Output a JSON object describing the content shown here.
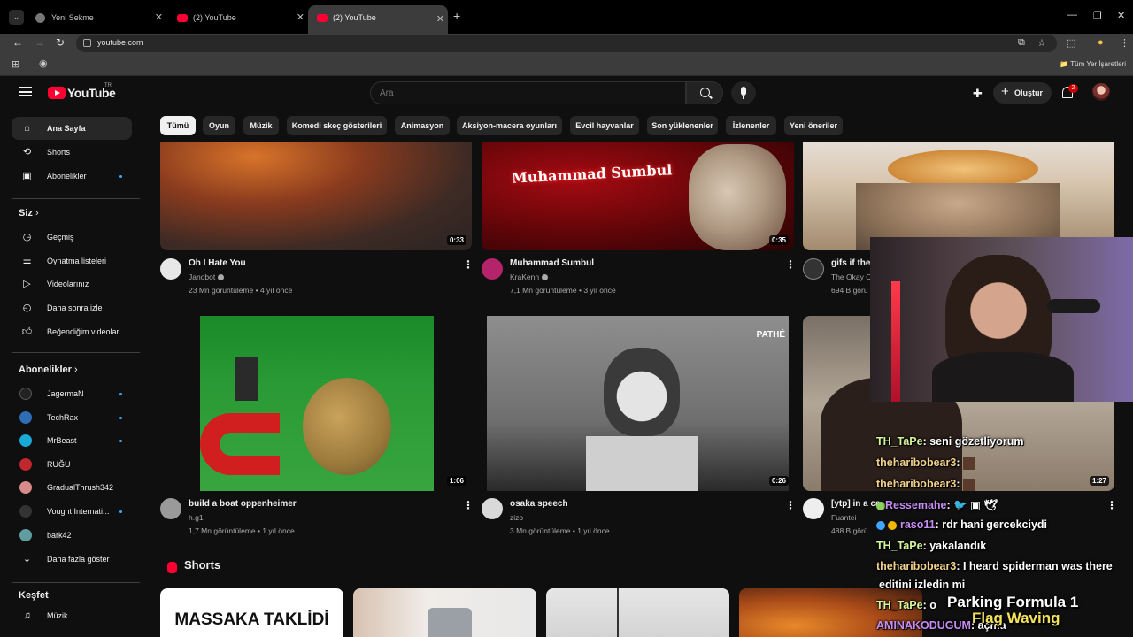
{
  "browser": {
    "tabs": [
      {
        "title": "Yeni Sekme"
      },
      {
        "title": "(2) YouTube"
      },
      {
        "title": "(2) YouTube"
      }
    ],
    "address": "youtube.com",
    "bookmarks_right": "Tüm Yer İşaretleri"
  },
  "masthead": {
    "logo_text": "YouTube",
    "country": "TR",
    "search_placeholder": "Ara",
    "create_label": "Oluştur",
    "notif_count": "2"
  },
  "sidebar": {
    "main": [
      {
        "label": "Ana Sayfa",
        "icon": "home-icon"
      },
      {
        "label": "Shorts",
        "icon": "shorts-icon"
      },
      {
        "label": "Abonelikler",
        "icon": "subscriptions-icon"
      }
    ],
    "you_header": "Siz",
    "you": [
      {
        "label": "Geçmiş",
        "icon": "history-icon"
      },
      {
        "label": "Oynatma listeleri",
        "icon": "playlist-icon"
      },
      {
        "label": "Videolarınız",
        "icon": "your-videos-icon"
      },
      {
        "label": "Daha sonra izle",
        "icon": "watch-later-icon"
      },
      {
        "label": "Beğendiğim videolar",
        "icon": "like-icon"
      }
    ],
    "subs_header": "Abonelikler",
    "subs": [
      {
        "label": "JagermaN",
        "color": "#222222"
      },
      {
        "label": "TechRax",
        "color": "#2f6db5"
      },
      {
        "label": "MrBeast",
        "color": "#1aa9d6"
      },
      {
        "label": "RUĞU",
        "color": "#c0282d"
      },
      {
        "label": "GradualThrush342",
        "color": "#d98a8a"
      },
      {
        "label": "Vought Internati...",
        "color": "#333333"
      },
      {
        "label": "bark42",
        "color": "#5f9ea0"
      }
    ],
    "show_more": "Daha fazla göster",
    "explore_header": "Keşfet",
    "explore": [
      {
        "label": "Müzik",
        "icon": "music-icon"
      }
    ]
  },
  "chips": [
    "Tümü",
    "Oyun",
    "Müzik",
    "Komedi skeç gösterileri",
    "Animasyon",
    "Aksiyon-macera oyunları",
    "Evcil hayvanlar",
    "Son yüklenenler",
    "İzlenenler",
    "Yeni öneriler"
  ],
  "videos": [
    {
      "title": "Oh I Hate You",
      "channel": "Janobot",
      "views": "23 Mn görüntüleme",
      "age": "4 yıl önce",
      "duration": "0:33"
    },
    {
      "title": "Muhammad Sumbul",
      "channel": "KraKenn",
      "views": "7,1 Mn görüntüleme",
      "age": "3 yıl önce",
      "duration": "0:35",
      "thumb_text": "Muhammad Sumbul"
    },
    {
      "title": "gifs if the",
      "channel": "The Okay C",
      "views": "694 B görü",
      "age": "",
      "duration": ""
    },
    {
      "title": "build a boat oppenheimer",
      "channel": "h.g1",
      "views": "1,7 Mn görüntüleme",
      "age": "1 yıl önce",
      "duration": "1:06"
    },
    {
      "title": "osaka speech",
      "channel": "zizo",
      "views": "3 Mn görüntüleme",
      "age": "1 yıl önce",
      "duration": "0:26",
      "thumb_text": "PATHÉ"
    },
    {
      "title": "[ytp] in a ca",
      "channel": "Fuantei",
      "views": "488 B görü",
      "age": "",
      "duration": "1:27"
    }
  ],
  "shorts": {
    "header": "Shorts",
    "first_text": "MASSAKA TAKLİDİ"
  },
  "chat": [
    {
      "user": "TH_TaPe",
      "msg": ": seni gözetliyorum",
      "cls": "cu-g"
    },
    {
      "user": "theharibobear3",
      "msg": ":",
      "cls": "cu-y"
    },
    {
      "user": "theharibobear3",
      "msg": ":",
      "cls": "cu-y"
    },
    {
      "user": "Ressemahe",
      "msg": ":",
      "cls": "cu-p"
    },
    {
      "user": "raso11",
      "msg": ": rdr hani gercekciydi",
      "cls": "cu-p"
    },
    {
      "user": "TH_TaPe",
      "msg": ": yakalandık",
      "cls": "cu-g"
    },
    {
      "user": "theharibobear3",
      "msg": ": I heard spiderman was there",
      "cls": "cu-y"
    },
    {
      "user": "",
      "msg": "editini izledin mi",
      "cls": "cu-y"
    },
    {
      "user": "TH_TaPe",
      "msg": ": o",
      "cls": "cu-g"
    },
    {
      "user": "AMINAKODUGUM",
      "msg": ": açma",
      "cls": "cu-p"
    }
  ],
  "overlay": {
    "line1": "Parking Formula 1",
    "line2": "Flag Waving"
  }
}
